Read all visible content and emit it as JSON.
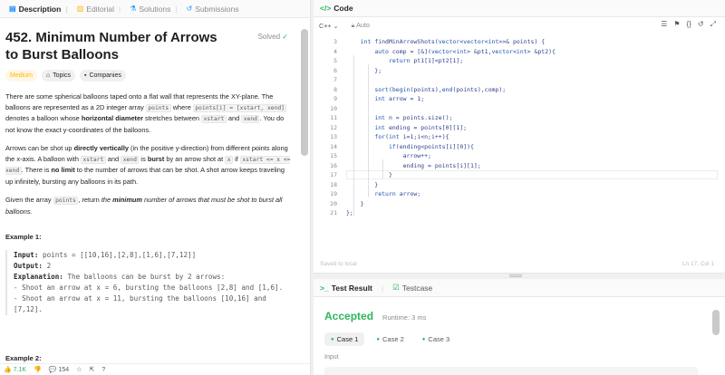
{
  "left_tabs": [
    {
      "icon": "document-icon",
      "label": "Description"
    },
    {
      "icon": "book-icon",
      "label": "Editorial"
    },
    {
      "icon": "flask-icon",
      "label": "Solutions"
    },
    {
      "icon": "history-icon",
      "label": "Submissions"
    }
  ],
  "problem": {
    "title": "452. Minimum Number of Arrows to Burst Balloons",
    "solved_label": "Solved",
    "difficulty": "Medium",
    "topics_label": "Topics",
    "companies_label": "Companies"
  },
  "description": {
    "p1_a": "There are some spherical balloons taped onto a flat wall that represents the XY-plane. The balloons are represented as a 2D integer array ",
    "p1_code1": "points",
    "p1_b": " where ",
    "p1_code2": "points[i] = [xstart, xend]",
    "p1_c": " denotes a balloon whose ",
    "p1_bold": "horizontal diameter",
    "p1_d": " stretches between ",
    "p1_code3": "xstart",
    "p1_e": " and ",
    "p1_code4": "xend",
    "p1_f": ". You do not know the exact y-coordinates of the balloons.",
    "p2_a": "Arrows can be shot up ",
    "p2_bold1": "directly vertically",
    "p2_b": " (in the positive y-direction) from different points along the x-axis. A balloon with ",
    "p2_code1": "xstart",
    "p2_c": " and ",
    "p2_code2": "xend",
    "p2_d": " is ",
    "p2_bold2": "burst",
    "p2_e": " by an arrow shot at ",
    "p2_code3": "x",
    "p2_f": " if ",
    "p2_code4": "xstart <= x <= xend",
    "p2_g": ". There is ",
    "p2_bold3": "no limit",
    "p2_h": " to the number of arrows that can be shot. A shot arrow keeps traveling up infinitely, bursting any balloons in its path.",
    "p3_a": "Given the array ",
    "p3_code": "points",
    "p3_b": ", return ",
    "p3_i1": "the ",
    "p3_bi": "minimum",
    "p3_i2": " number of arrows that must be shot to burst all balloons."
  },
  "example1": {
    "title": "Example 1:",
    "input_label": "Input:",
    "input_value": " points = [[10,16],[2,8],[1,6],[7,12]]",
    "output_label": "Output:",
    "output_value": " 2",
    "explanation_label": "Explanation:",
    "explanation_value": " The balloons can be burst by 2 arrows:",
    "line1": "- Shoot an arrow at x = 6, bursting the balloons [2,8] and [1,6].",
    "line2": "- Shoot an arrow at x = 11, bursting the balloons [10,16] and [7,12]."
  },
  "example2_title": "Example 2:",
  "footer": {
    "likes": "7.1K",
    "comments": "154"
  },
  "code": {
    "header": "Code",
    "language": "C++",
    "mode": "Auto",
    "saved_label": "Saved to local",
    "cursor_pos": "Ln 17, Col 1",
    "lines": [
      {
        "n": "3",
        "text": "    int findMinArrowShots(vector<vector<int>>& points) {"
      },
      {
        "n": "4",
        "text": "        auto comp = [&](vector<int> &pt1,vector<int> &pt2){"
      },
      {
        "n": "5",
        "text": "            return pt1[1]<pt2[1];"
      },
      {
        "n": "6",
        "text": "        };"
      },
      {
        "n": "7",
        "text": ""
      },
      {
        "n": "8",
        "text": "        sort(begin(points),end(points),comp);"
      },
      {
        "n": "9",
        "text": "        int arrow = 1;"
      },
      {
        "n": "10",
        "text": ""
      },
      {
        "n": "11",
        "text": "        int n = points.size();"
      },
      {
        "n": "12",
        "text": "        int ending = points[0][1];"
      },
      {
        "n": "13",
        "text": "        for(int i=1;i<n;i++){"
      },
      {
        "n": "14",
        "text": "            if(ending<points[i][0]){"
      },
      {
        "n": "15",
        "text": "                arrow++;"
      },
      {
        "n": "16",
        "text": "                ending = points[i][1];"
      },
      {
        "n": "17",
        "text": "            }"
      },
      {
        "n": "18",
        "text": "        }"
      },
      {
        "n": "19",
        "text": "        return arrow;"
      },
      {
        "n": "20",
        "text": "    }"
      },
      {
        "n": "21",
        "text": "};"
      }
    ]
  },
  "test": {
    "tab1": "Test Result",
    "tab2": "Testcase",
    "status": "Accepted",
    "runtime": "Runtime: 3 ms",
    "cases": [
      "Case 1",
      "Case 2",
      "Case 3"
    ],
    "input_label": "Input"
  },
  "colors": {
    "accepted": "#2db55d",
    "medium": "#ffb700",
    "accent": "#1a90ff"
  }
}
